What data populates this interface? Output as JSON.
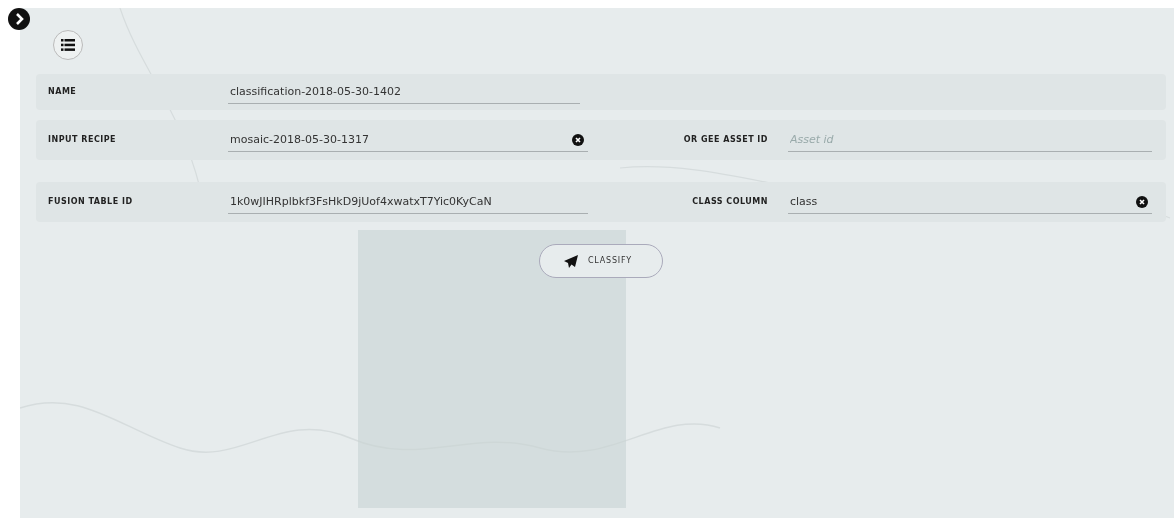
{
  "form": {
    "rows": [
      {
        "fields": [
          {
            "label": "NAME",
            "value": "classification-2018-05-30-1402",
            "clearable": false
          }
        ]
      },
      {
        "fields": [
          {
            "label": "INPUT RECIPE",
            "value": "mosaic-2018-05-30-1317",
            "clearable": true
          },
          {
            "label": "OR GEE ASSET ID",
            "placeholder": "Asset id",
            "clearable": false
          }
        ]
      },
      {
        "fields": [
          {
            "label": "FUSION TABLE ID",
            "value": "1k0wJIHRplbkf3FsHkD9jUof4xwatxT7Yic0KyCaN",
            "clearable": false
          },
          {
            "label": "CLASS COLUMN",
            "value": "class",
            "clearable": true
          }
        ]
      }
    ]
  },
  "submit_button": {
    "label": "CLASSIFY"
  }
}
